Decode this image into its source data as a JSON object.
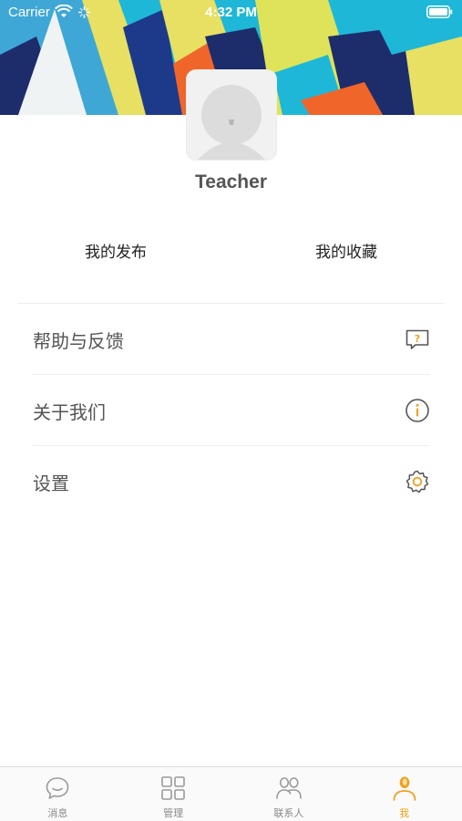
{
  "status_bar": {
    "carrier": "Carrier",
    "time": "4:32 PM"
  },
  "profile": {
    "username": "Teacher"
  },
  "quick_links": [
    {
      "label": "我的发布"
    },
    {
      "label": "我的收藏"
    }
  ],
  "menu": [
    {
      "label": "帮助与反馈",
      "icon": "help-feedback-icon"
    },
    {
      "label": "关于我们",
      "icon": "info-icon"
    },
    {
      "label": "设置",
      "icon": "settings-gear-icon"
    }
  ],
  "tab_bar": {
    "tabs": [
      {
        "label": "消息",
        "icon": "chat-bubble-icon",
        "active": false
      },
      {
        "label": "管理",
        "icon": "grid-icon",
        "active": false
      },
      {
        "label": "联系人",
        "icon": "contacts-icon",
        "active": false
      },
      {
        "label": "我",
        "icon": "person-icon",
        "active": true
      }
    ]
  },
  "colors": {
    "accent": "#f0a01e",
    "inactive_tab": "#888888",
    "banner_cyan": "#1fb7d8",
    "banner_yellow": "#e7e063",
    "banner_navy": "#1d2d6b",
    "banner_orange": "#f0652a"
  }
}
